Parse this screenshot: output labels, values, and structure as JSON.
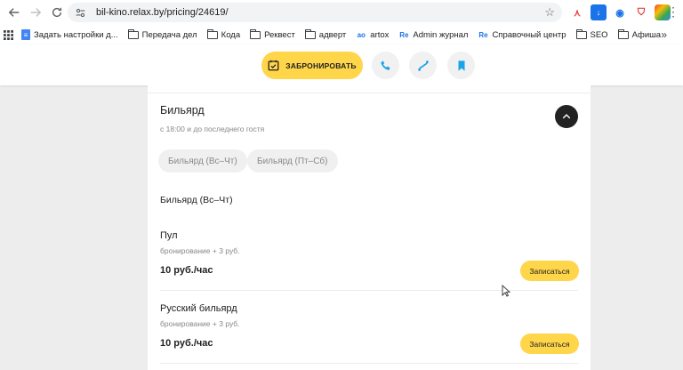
{
  "browser": {
    "url": "bil-kino.relax.by/pricing/24619/",
    "bookmarks": [
      {
        "label": "Задать настройки д...",
        "icon": "doc-icon"
      },
      {
        "label": "Передача дел",
        "icon": "folder-icon"
      },
      {
        "label": "Кода",
        "icon": "folder-icon"
      },
      {
        "label": "Реквест",
        "icon": "folder-icon"
      },
      {
        "label": "адверт",
        "icon": "folder-icon"
      },
      {
        "label": "artox",
        "icon": "site-icon"
      },
      {
        "label": "Admin журнал",
        "icon": "site-icon"
      },
      {
        "label": "Справочный центр",
        "icon": "site-icon"
      },
      {
        "label": "SEO",
        "icon": "folder-icon"
      },
      {
        "label": "Афиша",
        "icon": "folder-icon"
      }
    ]
  },
  "header": {
    "book_label": "ЗАБРОНИРОВАТЬ"
  },
  "section": {
    "title": "Бильярд",
    "subtitle": "с 18:00 и до последнего гостя",
    "chips": [
      "Бильярд (Вс–Чт)",
      "Бильярд (Пт–Сб)"
    ],
    "group_title": "Бильярд (Вс–Чт)",
    "items": [
      {
        "name": "Пул",
        "note": "бронирование + 3 руб.",
        "price": "10 руб./час",
        "button": "Записаться"
      },
      {
        "name": "Русский бильярд",
        "note": "бронирование + 3 руб.",
        "price": "10 руб./час",
        "button": "Записаться"
      }
    ]
  },
  "colors": {
    "accent_yellow": "#ffd54a",
    "icon_blue": "#1aa3e8",
    "dark": "#222222"
  }
}
